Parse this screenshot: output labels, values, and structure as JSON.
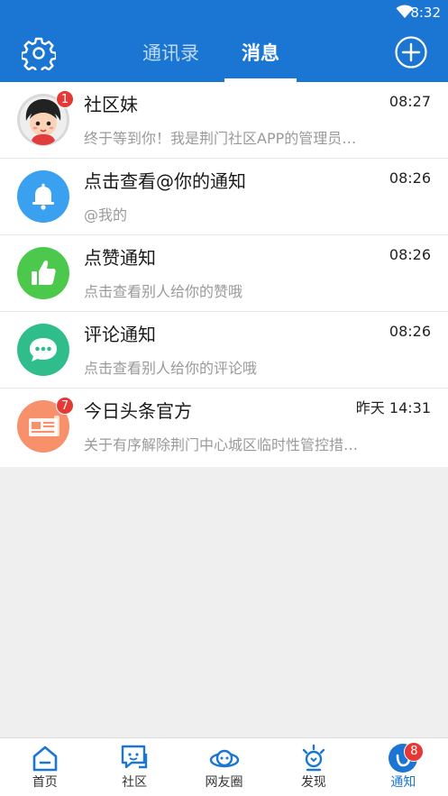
{
  "status_bar": {
    "time": "8:32",
    "wifi_icon": "wifi-icon"
  },
  "header": {
    "settings_icon": "gear-icon",
    "tabs": [
      {
        "label": "通讯录",
        "active": false
      },
      {
        "label": "消息",
        "active": true
      }
    ],
    "add_icon": "plus-circle-icon"
  },
  "messages": [
    {
      "name": "社区妹",
      "preview": "终于等到你！我是荆门社区APP的管理员…",
      "time": "08:27",
      "badge": "1",
      "avatar": "girl-avatar"
    },
    {
      "name": "点击查看@你的通知",
      "preview": "@我的",
      "time": "08:26",
      "badge": "",
      "avatar": "bell-icon"
    },
    {
      "name": "点赞通知",
      "preview": "点击查看别人给你的赞哦",
      "time": "08:26",
      "badge": "",
      "avatar": "thumbs-up-icon"
    },
    {
      "name": "评论通知",
      "preview": "点击查看别人给你的评论哦",
      "time": "08:26",
      "badge": "",
      "avatar": "comment-icon"
    },
    {
      "name": "今日头条官方",
      "preview": "关于有序解除荆门中心城区临时性管控措…",
      "time": "昨天 14:31",
      "badge": "7",
      "avatar": "newspaper-icon"
    }
  ],
  "bottom_nav": [
    {
      "label": "首页",
      "icon": "home-icon",
      "active": false
    },
    {
      "label": "社区",
      "icon": "community-icon",
      "active": false
    },
    {
      "label": "网友圈",
      "icon": "planet-icon",
      "active": false
    },
    {
      "label": "发现",
      "icon": "discover-icon",
      "active": false
    },
    {
      "label": "通知",
      "icon": "notification-icon",
      "active": true,
      "badge": "8"
    }
  ],
  "colors": {
    "primary": "#1a76d2",
    "badge": "#e53935",
    "bell_blue": "#3aa0f0",
    "like_green": "#4cc94c",
    "comment_teal": "#2fbd8c",
    "news_orange": "#f7916b"
  }
}
